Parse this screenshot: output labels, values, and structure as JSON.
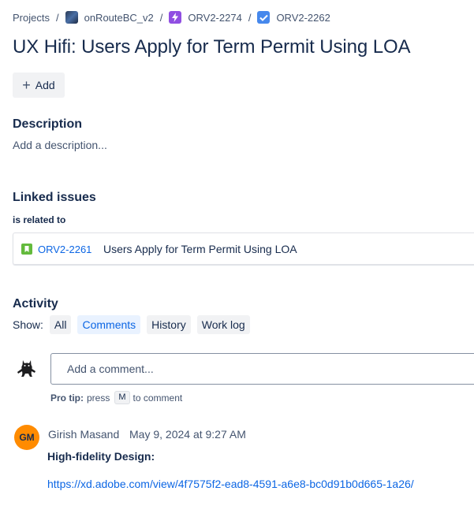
{
  "breadcrumb": {
    "projects": "Projects",
    "project": "onRouteBC_v2",
    "epic": "ORV2-2274",
    "task": "ORV2-2262"
  },
  "issue": {
    "title": "UX Hifi: Users Apply for Term Permit Using LOA",
    "add_label": "Add"
  },
  "description": {
    "heading": "Description",
    "placeholder": "Add a description..."
  },
  "linked_issues": {
    "heading": "Linked issues",
    "relation": "is related to",
    "items": [
      {
        "key": "ORV2-2261",
        "summary": "Users Apply for Term Permit Using LOA",
        "type_icon": "story-icon"
      }
    ]
  },
  "activity": {
    "heading": "Activity",
    "show_label": "Show:",
    "filters": [
      "All",
      "Comments",
      "History",
      "Work log"
    ],
    "active_filter": "Comments",
    "comment_placeholder": "Add a comment...",
    "protip_label": "Pro tip:",
    "protip_press": "press",
    "protip_key": "M",
    "protip_tail": "to comment",
    "comments": [
      {
        "initials": "GM",
        "author": "Girish Masand",
        "time": "May 9, 2024 at 9:27 AM",
        "body_bold": "High-fidelity Design:",
        "link": "https://xd.adobe.com/view/4f7575f2-ead8-4591-a6e8-bc0d91b0d665-1a26/"
      }
    ]
  },
  "colors": {
    "link": "#0c66e4",
    "avatar_gm": "#ff8b00",
    "story": "#63ba3c",
    "epic": "#904ee2",
    "task": "#4688ec"
  }
}
